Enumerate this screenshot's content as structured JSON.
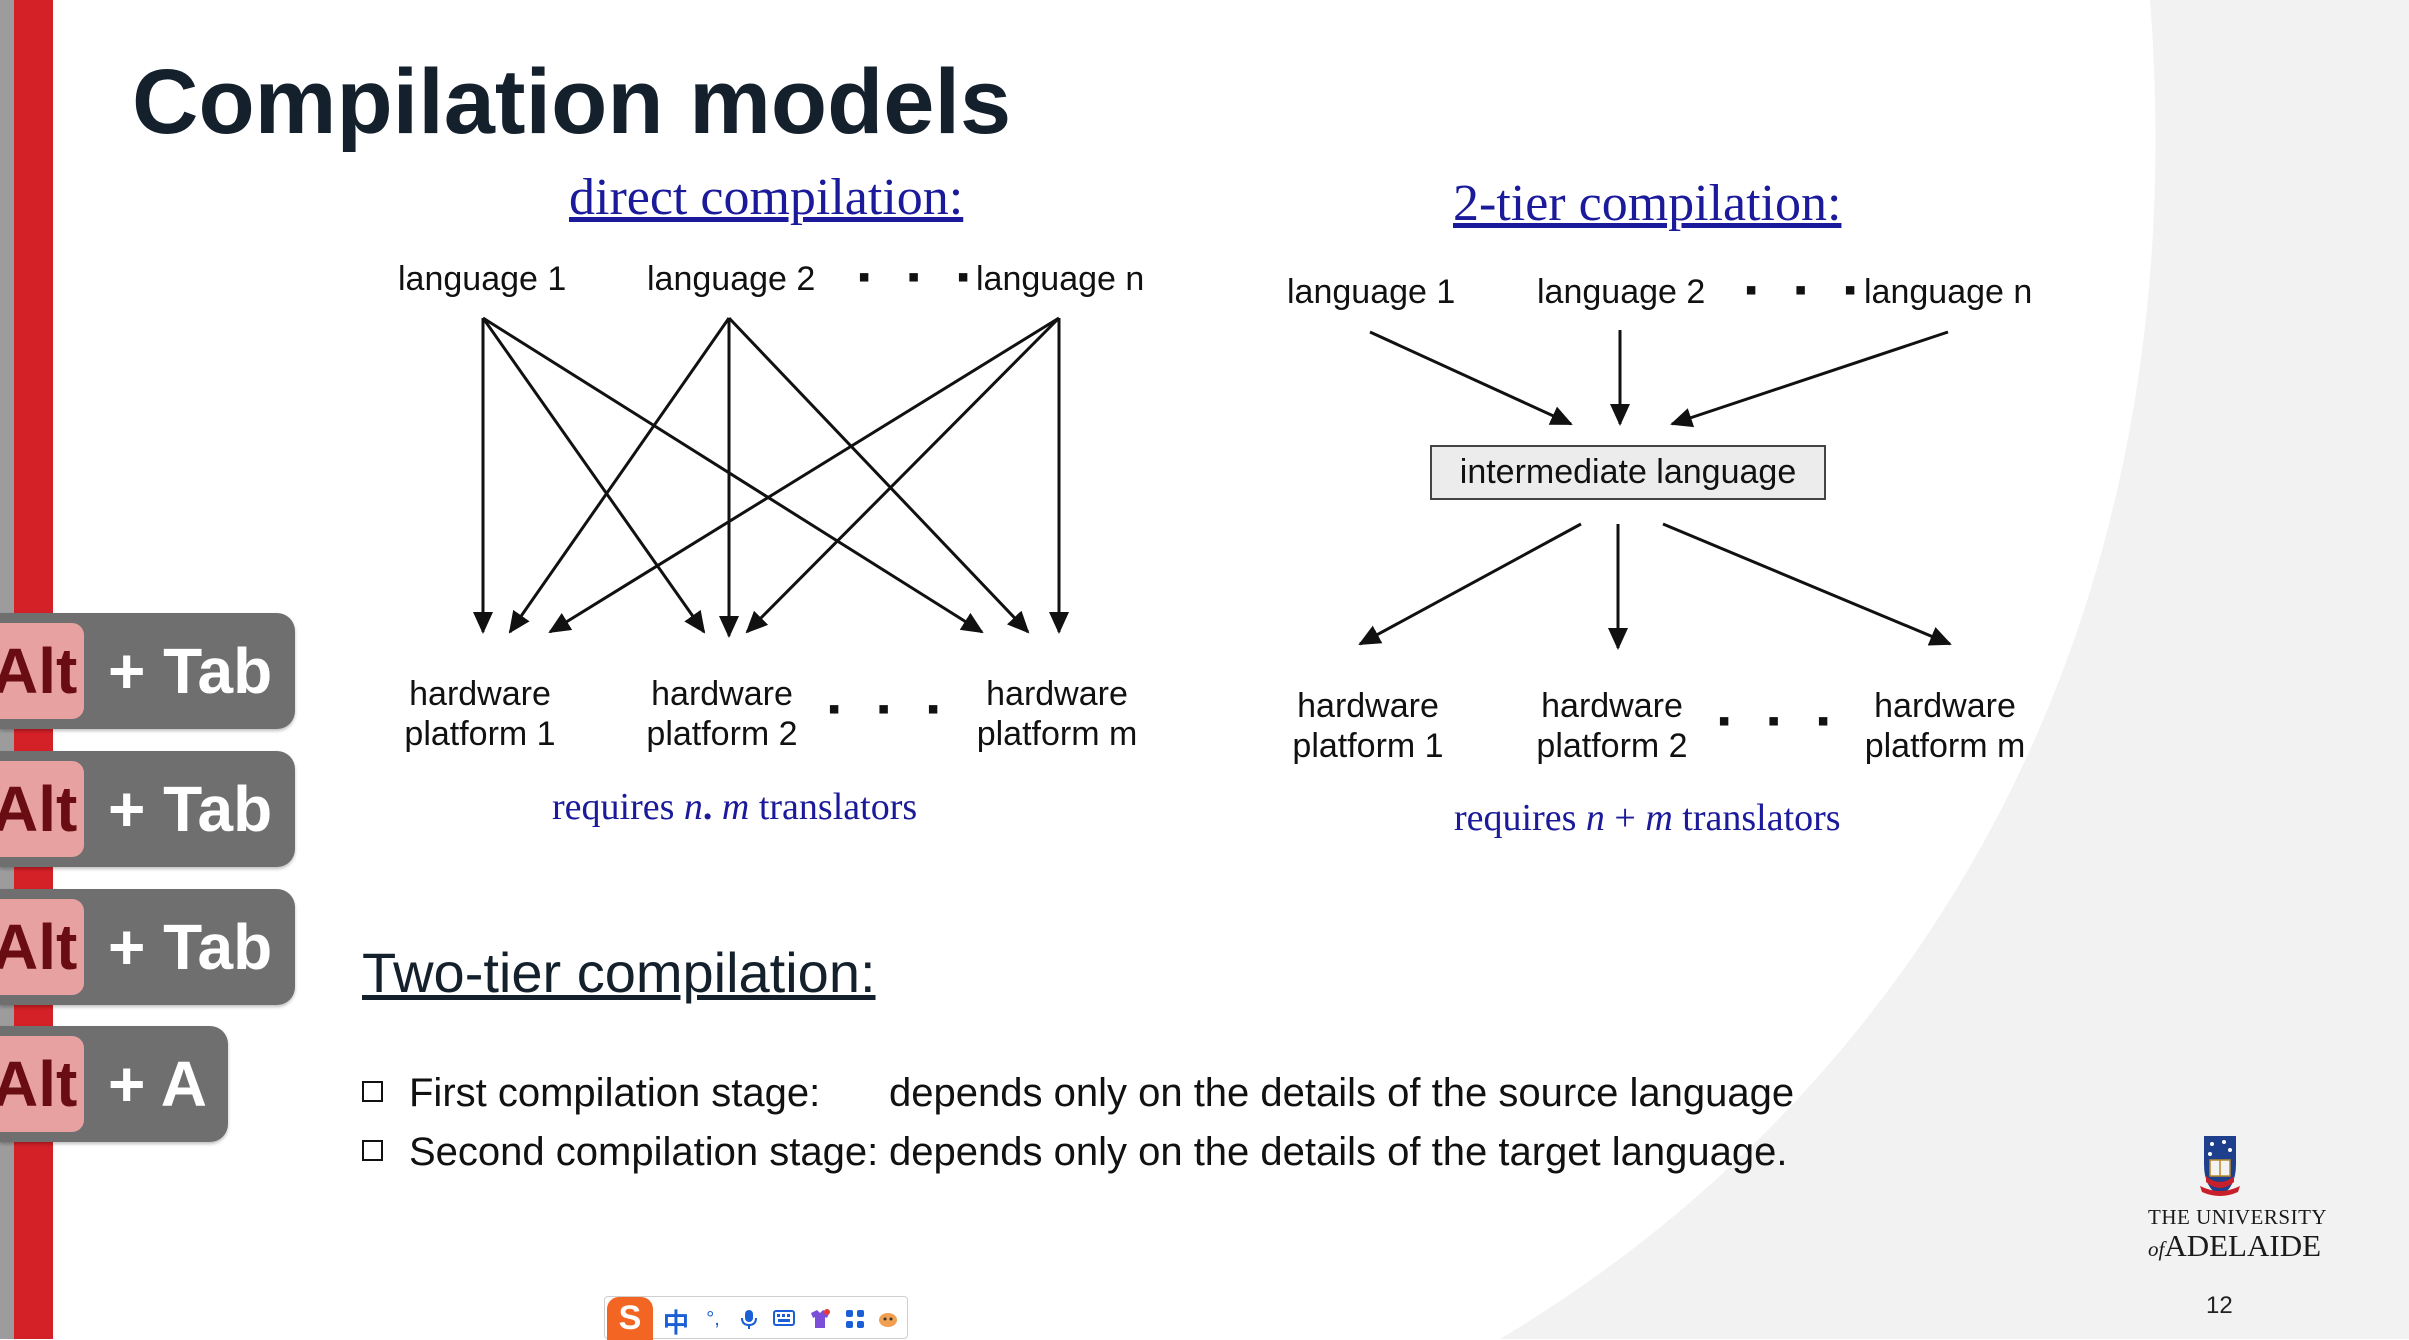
{
  "slide": {
    "title": "Compilation models",
    "page_number": "12"
  },
  "direct": {
    "heading": "direct compilation:",
    "languages": [
      "language 1",
      "language 2",
      "language n"
    ],
    "platforms": [
      {
        "line1": "hardware",
        "line2": "platform 1"
      },
      {
        "line1": "hardware",
        "line2": "platform 2"
      },
      {
        "line1": "hardware",
        "line2": "platform m"
      }
    ],
    "requires_prefix": "requires",
    "var_n": "n",
    "operator": ".",
    "var_m": "m",
    "requires_suffix": "translators"
  },
  "two_tier": {
    "heading": "2-tier compilation:",
    "languages": [
      "language 1",
      "language 2",
      "language n"
    ],
    "intermediate": "intermediate language",
    "platforms": [
      {
        "line1": "hardware",
        "line2": "platform 1"
      },
      {
        "line1": "hardware",
        "line2": "platform 2"
      },
      {
        "line1": "hardware",
        "line2": "platform m"
      }
    ],
    "requires_prefix": "requires",
    "var_n": "n",
    "operator": "+",
    "var_m": "m",
    "requires_suffix": "translators"
  },
  "ellipsis": "▪ ▪ ▪",
  "section": {
    "subtitle": "Two-tier compilation:",
    "bullets": [
      {
        "stage": "First compilation stage:",
        "text": "depends only on the details of the source language"
      },
      {
        "stage": "Second compilation stage:",
        "text": "depends only on the details of the target language."
      }
    ]
  },
  "shortcuts": [
    {
      "alt": "Alt",
      "rest": "+ Tab"
    },
    {
      "alt": "Alt",
      "rest": "+ Tab"
    },
    {
      "alt": "Alt",
      "rest": "+ Tab"
    },
    {
      "alt": "Alt",
      "rest": "+ A"
    }
  ],
  "ime_toolbar": {
    "logo": "S",
    "mode": "中",
    "icons": [
      "punctuation-icon",
      "microphone-icon",
      "keyboard-icon",
      "skin-icon",
      "toolbox-icon",
      "settings-icon"
    ]
  },
  "university": {
    "line1": "THE UNIVERSITY",
    "prefix": "of",
    "name": "ADELAIDE"
  },
  "colors": {
    "red_bar": "#d42027",
    "title": "#14202c",
    "serif_blue": "#1a1a9a",
    "background_gray": "#f2f2f2"
  }
}
